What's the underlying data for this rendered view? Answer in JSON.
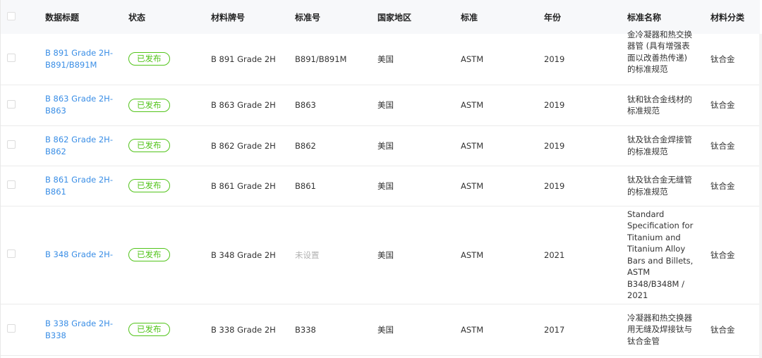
{
  "table": {
    "headers": {
      "title": "数据标题",
      "status": "状态",
      "material_grade": "材料牌号",
      "standard_no": "标准号",
      "country": "国家地区",
      "standard": "标准",
      "year": "年份",
      "standard_name": "标准名称",
      "material_class": "材料分类"
    },
    "rows": [
      {
        "title": "B 891 Grade 2H-B891/B891M",
        "status": "已发布",
        "material_grade": "B 891 Grade 2H",
        "standard_no": "B891/B891M",
        "country": "美国",
        "standard": "ASTM",
        "year": "2019",
        "standard_name": "金冷凝器和热交换器管 (具有增强表面以改善热传递) 的标准规范",
        "material_class": "钛合金"
      },
      {
        "title": "B 863 Grade 2H-B863",
        "status": "已发布",
        "material_grade": "B 863 Grade 2H",
        "standard_no": "B863",
        "country": "美国",
        "standard": "ASTM",
        "year": "2019",
        "standard_name": "钛和钛合金线材的标准规范",
        "material_class": "钛合金"
      },
      {
        "title": "B 862 Grade 2H-B862",
        "status": "已发布",
        "material_grade": "B 862 Grade 2H",
        "standard_no": "B862",
        "country": "美国",
        "standard": "ASTM",
        "year": "2019",
        "standard_name": "钛及钛合金焊接管的标准规范",
        "material_class": "钛合金"
      },
      {
        "title": "B 861 Grade 2H-B861",
        "status": "已发布",
        "material_grade": "B 861 Grade 2H",
        "standard_no": "B861",
        "country": "美国",
        "standard": "ASTM",
        "year": "2019",
        "standard_name": "钛及钛合金无缝管的标准规范",
        "material_class": "钛合金"
      },
      {
        "title": "B 348 Grade 2H-",
        "status": "已发布",
        "material_grade": "B 348 Grade 2H",
        "standard_no": "未设置",
        "country": "美国",
        "standard": "ASTM",
        "year": "2021",
        "standard_name": "Standard Specification for Titanium and Titanium Alloy Bars and Billets, ASTM B348/B348M / 2021",
        "material_class": "钛合金"
      },
      {
        "title": "B 338 Grade 2H-B338",
        "status": "已发布",
        "material_grade": "B 338 Grade 2H",
        "standard_no": "B338",
        "country": "美国",
        "standard": "ASTM",
        "year": "2017",
        "standard_name": "冷凝器和热交换器用无缝及焊接钛与钛合金管",
        "material_class": "钛合金"
      }
    ]
  }
}
